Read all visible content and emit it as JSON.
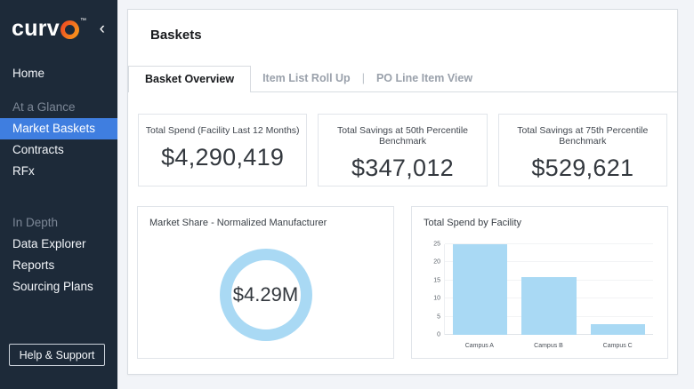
{
  "colors": {
    "sidebar_bg": "#1d2a39",
    "active_item_bg": "#3f7ee0",
    "chart_blue": "#a9d9f4",
    "logo_orange_start": "#ef4123",
    "logo_orange_end": "#f9a11b"
  },
  "sidebar": {
    "logo_prefix": "curv",
    "logo_ring_letter": "o",
    "trademark": "™",
    "collapse_icon": "‹",
    "items": [
      {
        "label": "Home",
        "type": "link"
      },
      {
        "label": "At a Glance",
        "type": "section"
      },
      {
        "label": "Market Baskets",
        "type": "active"
      },
      {
        "label": "Contracts",
        "type": "link"
      },
      {
        "label": "RFx",
        "type": "link"
      },
      {
        "label": "In Depth",
        "type": "section"
      },
      {
        "label": "Data Explorer",
        "type": "link"
      },
      {
        "label": "Reports",
        "type": "link"
      },
      {
        "label": "Sourcing Plans",
        "type": "link"
      }
    ],
    "help_button": "Help & Support"
  },
  "header": {
    "title": "Baskets"
  },
  "tabs": {
    "active": "Basket Overview",
    "inactive_1": "Item List Roll Up",
    "separator": "|",
    "inactive_2": "PO Line Item View"
  },
  "kpis": [
    {
      "label": "Total Spend (Facility Last 12 Months)",
      "value": "$4,290,419"
    },
    {
      "label": "Total Savings at 50th Percentile Benchmark",
      "value": "$347,012"
    },
    {
      "label": "Total Savings at 75th Percentile Benchmark",
      "value": "$529,621"
    }
  ],
  "chart_data": [
    {
      "type": "pie",
      "title": "Market Share - Normalized Manufacturer",
      "center_label": "$4.29M",
      "series": [
        {
          "name": "Normalized Manufacturer total",
          "value": 100
        }
      ],
      "ring_color": "#a9d9f4",
      "legend": "none"
    },
    {
      "type": "bar",
      "title": "Total Spend by Facility",
      "categories": [
        "Campus A",
        "Campus B",
        "Campus C"
      ],
      "values": [
        25,
        16,
        3
      ],
      "ylim": [
        0,
        25
      ],
      "yticks": [
        0,
        5,
        10,
        15,
        20,
        25
      ],
      "bar_color": "#a9d9f4",
      "grid": true,
      "xlabel": "",
      "ylabel": "",
      "legend": "none"
    }
  ]
}
